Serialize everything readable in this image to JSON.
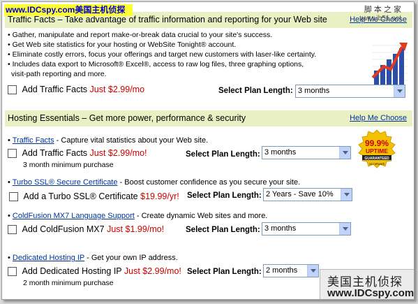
{
  "watermark": {
    "top_left": "www.IDCspy.com美国主机侦探",
    "top_right": "脚 本 之 家",
    "top_right_url": "www.jb51.net",
    "bottom_right_line1": "美国主机侦探",
    "bottom_right_line2": "www.IDCspy.com"
  },
  "traffic_facts_section": {
    "header": "Traffic Facts – Take advantage of traffic information and reporting for your Web site",
    "help_link": "Help Me Choose",
    "bullets": [
      "• Gather, manipulate and report make-or-break data crucial to your site's success.",
      "• Get Web site statistics for your hosting or WebSite Tonight® account.",
      "• Eliminate costly errors, focus your offerings and target new customers with laser-like certainty.",
      "• Includes data export to Microsoft® Excel®, access to raw log files, three graphing options,",
      "  visit-path reporting and more."
    ],
    "add_label": "Add Traffic Facts",
    "price": "Just $2.99/mo",
    "plan_label": "Select Plan Length:",
    "plan_value": "3 months"
  },
  "hosting_section": {
    "header": "Hosting Essentials – Get more power, performance & security",
    "help_link": "Help Me Choose",
    "badge": {
      "percent": "99.9%",
      "uptime": "UPTIME",
      "guaranteed": "GUARANTEED",
      "network": "on network"
    },
    "items": [
      {
        "link": "Traffic Facts",
        "desc": " - Capture vital statistics about your Web site.",
        "add_label": "Add Traffic Facts",
        "price": "Just $2.99/mo!",
        "plan_label": "Select Plan Length:",
        "plan_value": "3 months",
        "min": "3 month minimum purchase"
      },
      {
        "link": "Turbo SSL® Secure Certificate",
        "desc": " - Boost customer confidence as you secure your site.",
        "add_label": "Add a Turbo SSL® Certificate",
        "price": "$19.99/yr!",
        "plan_label": "Select Plan Length:",
        "plan_value": "2 Years - Save 10%",
        "min": ""
      },
      {
        "link": "ColdFusion MX7 Language Support",
        "desc": " - Create dynamic Web sites and more.",
        "add_label": "Add ColdFusion MX7",
        "price": "Just $1.99/mo!",
        "plan_label": "Select Plan Length:",
        "plan_value": "3 months",
        "min": ""
      },
      {
        "link": "Dedicated Hosting IP",
        "desc": " - Get your own IP address.",
        "add_label": "Add Dedicated Hosting IP",
        "price": "Just $2.99/mo!",
        "plan_label": "Select Plan Length:",
        "plan_value": "2 months",
        "min": "2 month minimum purchase"
      }
    ]
  },
  "colors": {
    "section_header_bg": "#e9f0c3",
    "price_red": "#cc0000",
    "link_blue": "#003399"
  }
}
